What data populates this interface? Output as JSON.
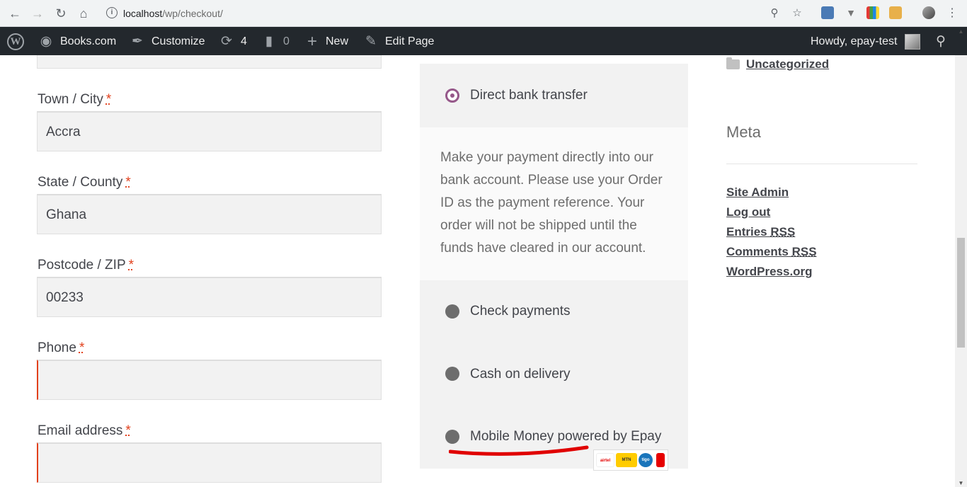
{
  "browser": {
    "url_host": "localhost",
    "url_path": "/wp/checkout/"
  },
  "adminbar": {
    "site_name": "Books.com",
    "customize": "Customize",
    "updates_count": "4",
    "comments_count": "0",
    "new": "New",
    "edit_page": "Edit Page",
    "howdy": "Howdy, epay-test"
  },
  "form": {
    "town_label": "Town / City",
    "town_value": "Accra",
    "state_label": "State / County",
    "state_value": "Ghana",
    "postcode_label": "Postcode / ZIP",
    "postcode_value": "00233",
    "phone_label": "Phone",
    "phone_value": "",
    "email_label": "Email address",
    "email_value": "",
    "required_mark": "*"
  },
  "payment": {
    "methods": [
      {
        "label": "Direct bank transfer",
        "selected": true
      },
      {
        "label": "Check payments",
        "selected": false
      },
      {
        "label": "Cash on delivery",
        "selected": false
      },
      {
        "label": "Mobile Money powered by Epay",
        "selected": false
      }
    ],
    "bank_description": "Make your payment directly into our bank account. Please use your Order ID as the payment reference. Your order will not be shipped until the funds have cleared in our account.",
    "underline_color": "#e00000",
    "selected_color": "#96588a"
  },
  "sidebar": {
    "category": "Uncategorized",
    "meta_title": "Meta",
    "links": {
      "site_admin": "Site Admin",
      "log_out": "Log out",
      "entries": "Entries ",
      "comments": "Comments ",
      "rss": "RSS",
      "wordpress_org": "WordPress.org"
    }
  }
}
